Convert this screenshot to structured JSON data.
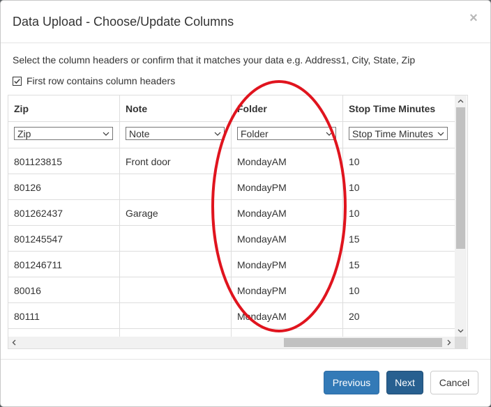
{
  "dialog": {
    "title": "Data Upload - Choose/Update Columns",
    "close_glyph": "×"
  },
  "instruction": "Select the column headers or confirm that it matches your data e.g. Address1, City, State, Zip",
  "first_row_checkbox": {
    "label": "First row contains column headers",
    "checked": true
  },
  "columns": [
    {
      "header": "Zip",
      "selected": "Zip"
    },
    {
      "header": "Note",
      "selected": "Note"
    },
    {
      "header": "Folder",
      "selected": "Folder"
    },
    {
      "header": "Stop Time Minutes",
      "selected": "Stop Time Minutes"
    }
  ],
  "rows": [
    [
      "801123815",
      "Front door",
      "MondayAM",
      "10"
    ],
    [
      "80126",
      "",
      "MondayPM",
      "10"
    ],
    [
      "801262437",
      "Garage",
      "MondayAM",
      "10"
    ],
    [
      "801245547",
      "",
      "MondayAM",
      "15"
    ],
    [
      "801246711",
      "",
      "MondayPM",
      "15"
    ],
    [
      "80016",
      "",
      "MondayPM",
      "10"
    ],
    [
      "80111",
      "",
      "MondayAM",
      "20"
    ]
  ],
  "footer": {
    "previous_label": "Previous",
    "next_label": "Next",
    "cancel_label": "Cancel"
  },
  "colors": {
    "primary": "#337ab7",
    "primary_active": "#286090",
    "annotation_red": "#e0141e"
  }
}
